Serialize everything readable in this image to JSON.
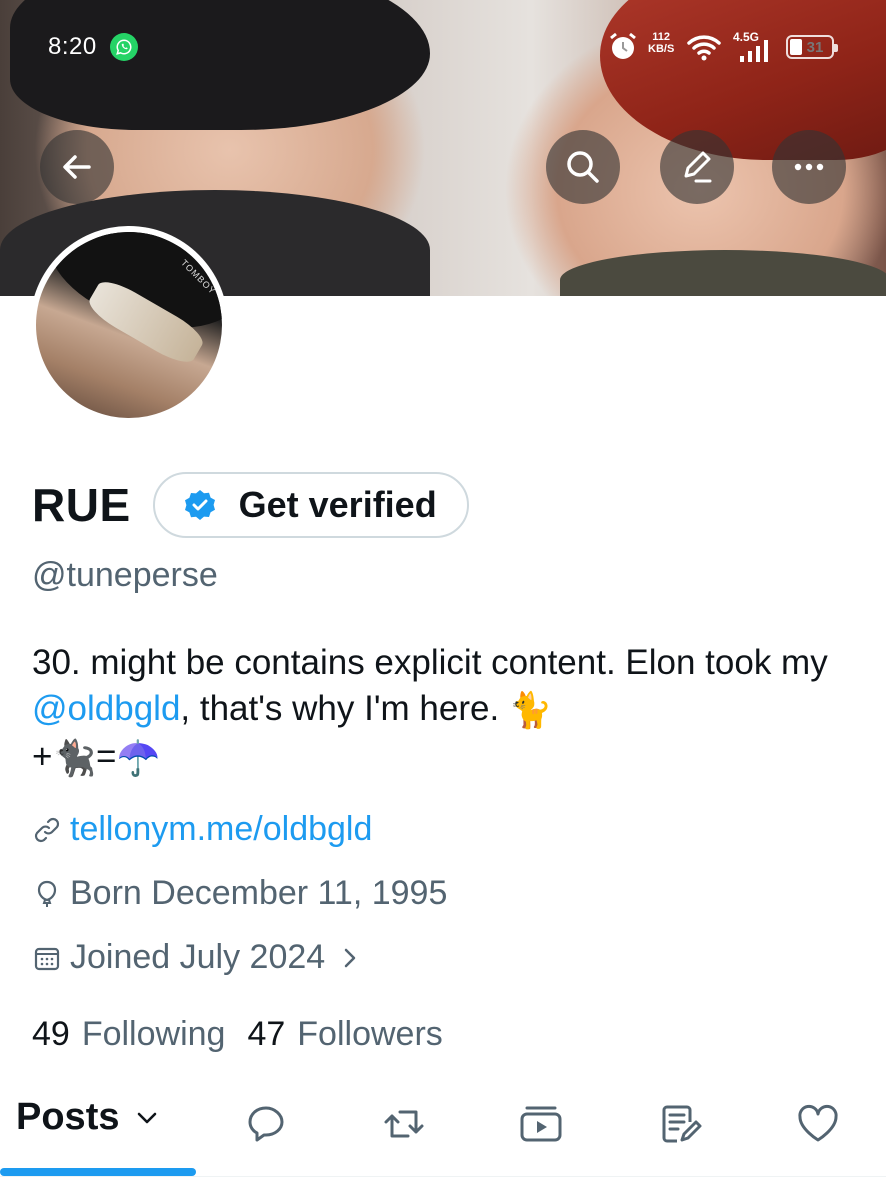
{
  "status_bar": {
    "time": "8:20",
    "speed_value": "112",
    "speed_unit": "KB/S",
    "network": "4.5G",
    "battery": "31"
  },
  "header": {
    "icons": [
      "arrow-left-icon",
      "search-icon",
      "edit-icon",
      "more-icon"
    ]
  },
  "profile": {
    "avatar_text": "TOMBOY",
    "display_name": "RUE",
    "verify_label": "Get verified",
    "handle": "@tuneperse",
    "bio_part1": "30. might be contains explicit content. Elon took my ",
    "bio_mention": "@oldbgld",
    "bio_part2": ", that's why I'm here. ",
    "bio_emoji1": "🐈",
    "bio_plus": "+",
    "bio_emoji2": "🐈‍⬛",
    "bio_equals": "=",
    "bio_emoji3": "☂️",
    "link": "tellonym.me/oldbgld",
    "born": "Born December 11, 1995",
    "joined": "Joined July 2024",
    "following_count": "49",
    "following_label": "Following",
    "followers_count": "47",
    "followers_label": "Followers"
  },
  "tabs": {
    "posts_label": "Posts",
    "icons": [
      "reply-icon",
      "repost-icon",
      "media-icon",
      "articles-icon",
      "like-icon"
    ]
  },
  "colors": {
    "accent": "#1d9bf0",
    "secondary_text": "#536471",
    "primary_text": "#0f1419"
  }
}
